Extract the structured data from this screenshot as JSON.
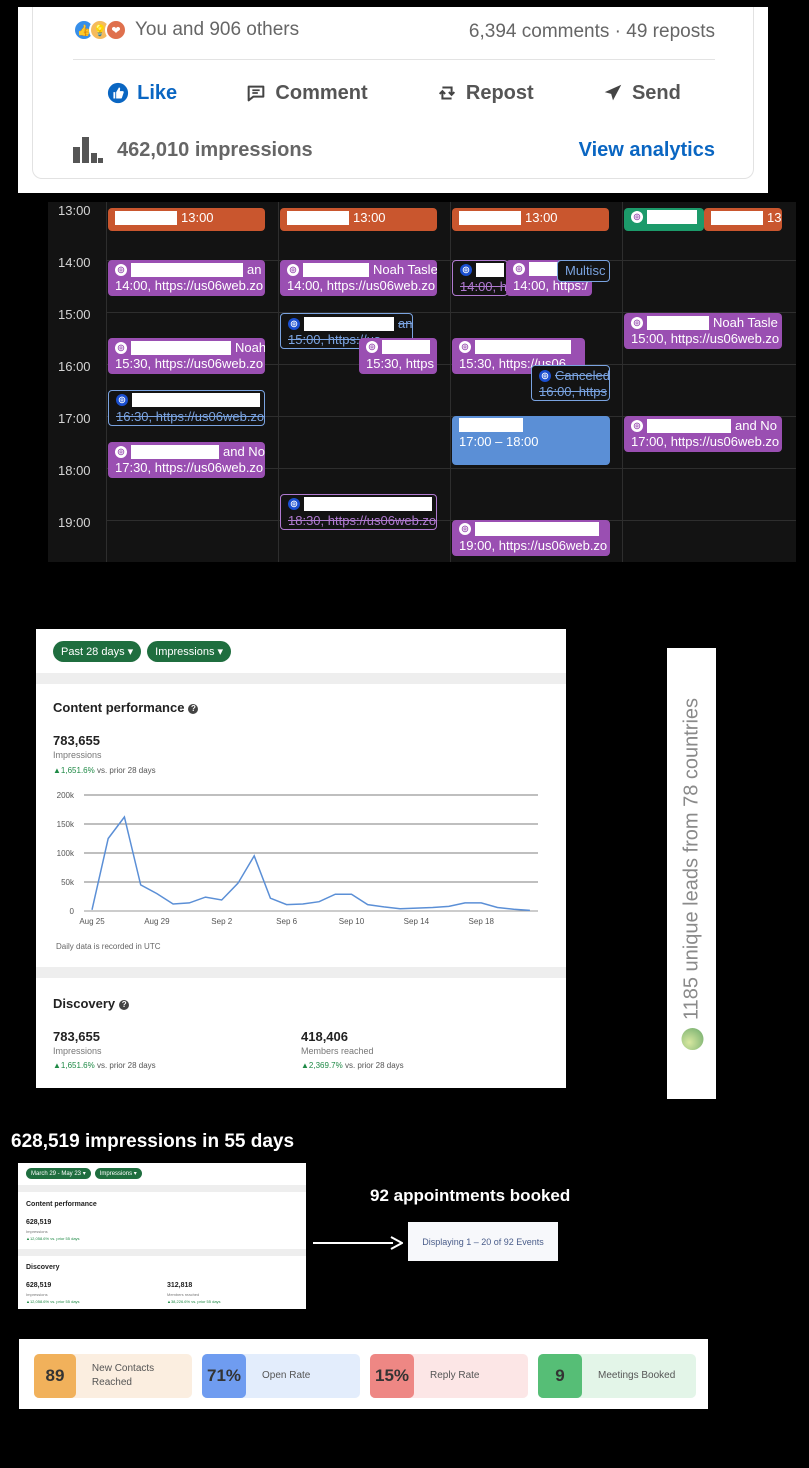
{
  "linkedin": {
    "reactions_text": "You and 906 others",
    "counts_text": "6,394 comments · 49 reposts",
    "actions": [
      "Like",
      "Comment",
      "Repost",
      "Send"
    ],
    "impressions_text": "462,010 impressions",
    "analytics_link": "View analytics",
    "colors": {
      "brand": "#0a66c2"
    }
  },
  "calendar": {
    "times": [
      "13:00",
      "14:00",
      "15:00",
      "16:00",
      "17:00",
      "18:00",
      "19:00"
    ],
    "events": {
      "e1": {
        "l1": "13:00"
      },
      "e2": {
        "l1": "13:00"
      },
      "e3": {
        "l1": "13:00"
      },
      "e4": {
        "l1": "13"
      },
      "e5": {
        "l1": "an",
        "l2": "14:00, https://us06web.zo"
      },
      "e6": {
        "l1": "Noah Tasle",
        "l2": "14:00, https://us06web.zo"
      },
      "e7": {
        "l2": "14:00, h"
      },
      "e8": {
        "l1": "Multisc",
        "l2": "14:00, https:/"
      },
      "e9": {
        "l1": "an",
        "l2": "15:00, https://us"
      },
      "e10": {
        "l1": "Noah Tasle",
        "l2": "15:00, https://us06web.zo"
      },
      "e11": {
        "l1": "Noah",
        "l2": "15:30, https://us06web.zo"
      },
      "e12": {
        "l2": "15:30, https"
      },
      "e13": {
        "l2": "15:30, https://us06"
      },
      "e14": {
        "l1": "Canceled",
        "l2": "16:00, https"
      },
      "e15": {
        "l2": "16:30, https://us06web.zo"
      },
      "e16": {
        "l2": "17:00 – 18:00"
      },
      "e17": {
        "l1": "and No",
        "l2": "17:00, https://us06web.zo"
      },
      "e18": {
        "l1": "and No",
        "l2": "17:30, https://us06web.zo"
      },
      "e19": {
        "l2": "18:30, https://us06web.zo"
      },
      "e20": {
        "l2": "19:00, https://us06web.zo"
      }
    }
  },
  "analytics": {
    "filters": [
      "Past 28 days",
      "Impressions"
    ],
    "content_title": "Content performance",
    "impressions_value": "783,655",
    "impressions_label": "Impressions",
    "delta": "1,651.6%",
    "delta_suffix": "vs. prior 28 days",
    "note": "Daily data is recorded in UTC",
    "discovery_title": "Discovery",
    "members_value": "418,406",
    "members_label": "Members reached",
    "members_delta": "2,369.7%"
  },
  "chart_data": {
    "type": "line",
    "title": "",
    "xlabel": "",
    "ylabel": "",
    "x_ticks": [
      "Aug 25",
      "Aug 29",
      "Sep 2",
      "Sep 6",
      "Sep 10",
      "Sep 14",
      "Sep 18"
    ],
    "y_ticks": [
      "0",
      "50k",
      "100k",
      "150k",
      "200k"
    ],
    "ylim": [
      0,
      200000
    ],
    "x": [
      "Aug 25",
      "Aug 26",
      "Aug 27",
      "Aug 28",
      "Aug 29",
      "Aug 30",
      "Aug 31",
      "Sep 1",
      "Sep 2",
      "Sep 3",
      "Sep 4",
      "Sep 5",
      "Sep 6",
      "Sep 7",
      "Sep 8",
      "Sep 9",
      "Sep 10",
      "Sep 11",
      "Sep 12",
      "Sep 13",
      "Sep 14",
      "Sep 15",
      "Sep 16",
      "Sep 17",
      "Sep 18",
      "Sep 19",
      "Sep 20",
      "Sep 21"
    ],
    "values": [
      2000,
      125000,
      162000,
      45000,
      30000,
      12000,
      14000,
      24000,
      19000,
      48000,
      95000,
      22000,
      11000,
      12000,
      16000,
      29000,
      29000,
      11000,
      7000,
      4000,
      5000,
      6000,
      8000,
      14000,
      14000,
      6000,
      3000,
      1000
    ],
    "grid": true
  },
  "leads": {
    "text": "1185 unique leads from 78 countries"
  },
  "summary": {
    "headline": "628,519 impressions in 55 days",
    "mini_filters": [
      "March 29 - May 23",
      "Impressions"
    ],
    "mini_content_title": "Content performance",
    "mini_value": "628,519",
    "mini_label": "Impressions",
    "mini_delta": "▲12,058.6% vs. prior 55 days",
    "mini_discovery_title": "Discovery",
    "mini_members_value": "312,818",
    "mini_members_label": "Members reached",
    "mini_members_delta": "▲38,226.6% vs. prior 55 days",
    "appointments_headline": "92 appointments booked",
    "appointments_box": "Displaying 1 – 20 of 92 Events"
  },
  "stats": [
    {
      "value": "89",
      "label": "New Contacts Reached",
      "color": "#f1b15b",
      "bg": "#fbeee0"
    },
    {
      "value": "71%",
      "label": "Open Rate",
      "color": "#6f9cf0",
      "bg": "#e3edfc"
    },
    {
      "value": "15%",
      "label": "Reply Rate",
      "color": "#ee8784",
      "bg": "#fce6e6"
    },
    {
      "value": "9",
      "label": "Meetings Booked",
      "color": "#56be76",
      "bg": "#e3f5e8"
    }
  ]
}
